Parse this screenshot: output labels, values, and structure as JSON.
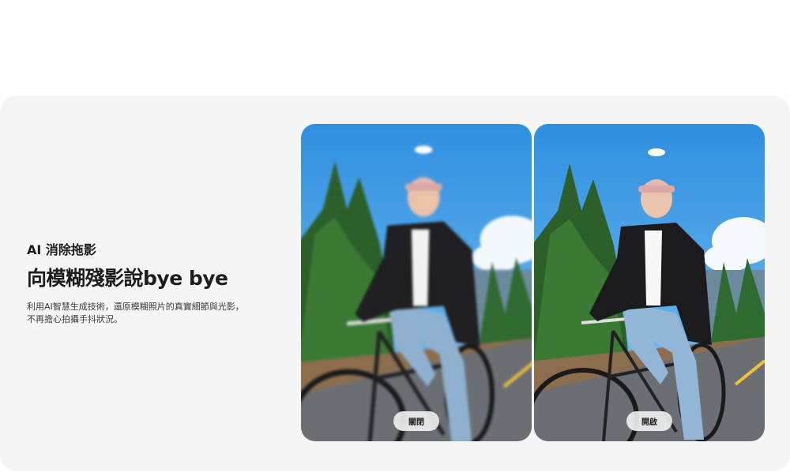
{
  "section": {
    "eyebrow": "AI 消除拖影",
    "headline": "向模糊殘影說bye bye",
    "description_lines": [
      "利用AI智慧生成技術，還原模糊照片的真實細節與光影，",
      "不再擔心拍攝手抖狀況。"
    ]
  },
  "comparison": {
    "before": {
      "image": "blurry-cyclist-photo",
      "toggle_label": "關閉"
    },
    "after": {
      "image": "sharp-cyclist-photo",
      "toggle_label": "開啟"
    }
  },
  "colors": {
    "card_background": "#f5f5f5",
    "text_primary": "#1d1d1f",
    "sky": "#3f9be6",
    "pill": "#eeeeee"
  }
}
